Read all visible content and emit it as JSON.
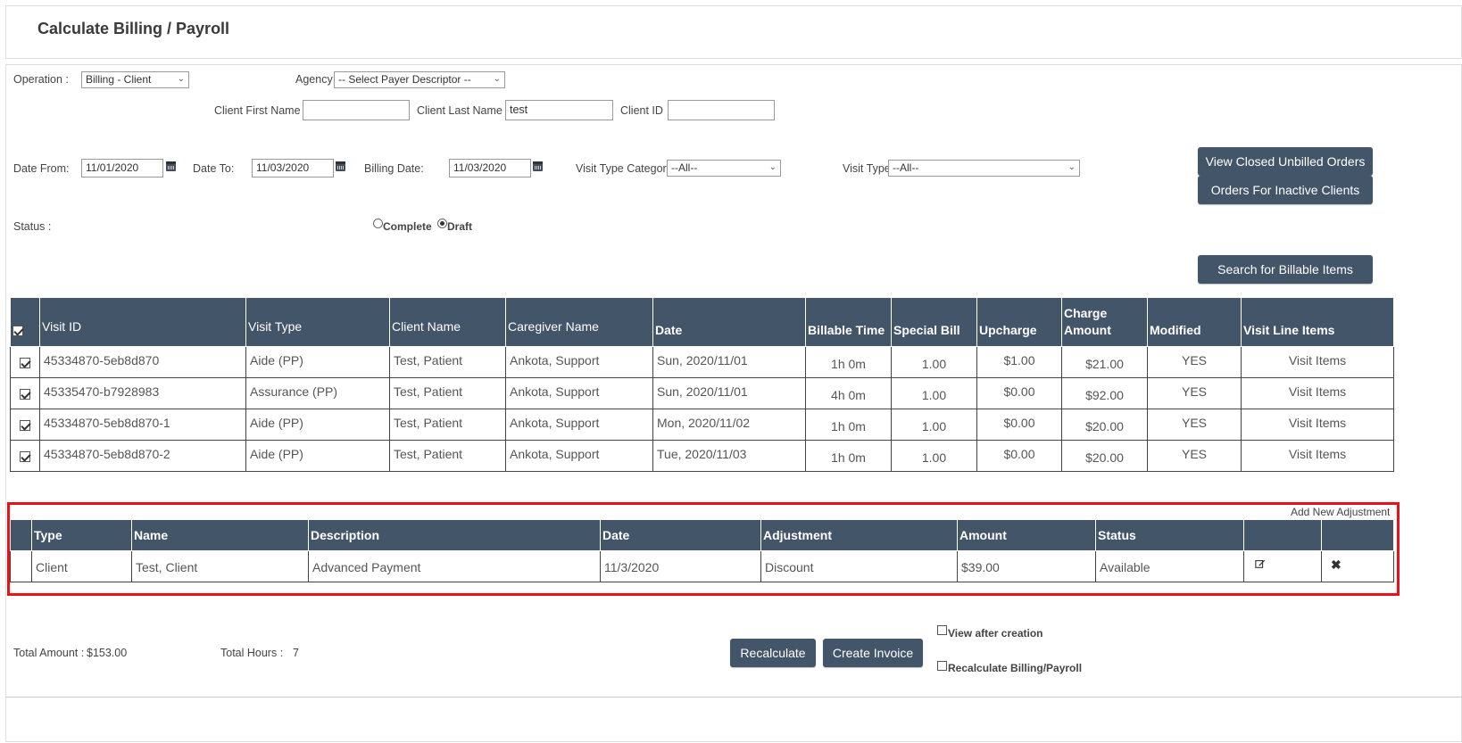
{
  "page": {
    "title": "Calculate Billing / Payroll"
  },
  "filters": {
    "operation_label": "Operation :",
    "operation_value": "Billing - Client",
    "agency_label": "Agency:",
    "agency_value": "-- Select Payer Descriptor --",
    "client_first_name_label": "Client First Name",
    "client_first_name_value": "",
    "client_last_name_label": "Client Last Name",
    "client_last_name_value": "test",
    "client_id_label": "Client ID",
    "client_id_value": "",
    "date_from_label": "Date From:",
    "date_from_value": "11/01/2020",
    "date_to_label": "Date To:",
    "date_to_value": "11/03/2020",
    "billing_date_label": "Billing Date:",
    "billing_date_value": "11/03/2020",
    "visit_type_category_label": "Visit Type Category",
    "visit_type_category_value": "--All--",
    "visit_type_label": "Visit Type",
    "visit_type_value": "--All--",
    "status_label": "Status :",
    "status_options": [
      "Complete",
      "Draft"
    ],
    "status_selected": "Draft"
  },
  "buttons": {
    "view_closed_unbilled": "View Closed Unbilled Orders",
    "orders_inactive_clients": "Orders For Inactive Clients",
    "search_billable": "Search for Billable Items",
    "recalculate": "Recalculate",
    "create_invoice": "Create Invoice"
  },
  "visits_table": {
    "headers": [
      "Visit ID",
      "Visit Type",
      "Client Name",
      "Caregiver Name",
      "Date",
      "Billable Time",
      "Special Bill",
      "Upcharge",
      "Charge Amount",
      "Modified",
      "Visit Line Items"
    ],
    "rows": [
      {
        "checked": true,
        "visit_id": "45334870-5eb8d870",
        "visit_type": "Aide (PP)",
        "client_name": "Test, Patient",
        "caregiver_name": "Ankota, Support",
        "date": "Sun, 2020/11/01",
        "billable_time": "1h 0m",
        "special_bill": "1.00",
        "upcharge": "$1.00",
        "charge_amount": "$21.00",
        "modified": "YES",
        "line_items": "Visit Items"
      },
      {
        "checked": true,
        "visit_id": "45335470-b7928983",
        "visit_type": "Assurance (PP)",
        "client_name": "Test, Patient",
        "caregiver_name": "Ankota, Support",
        "date": "Sun, 2020/11/01",
        "billable_time": "4h 0m",
        "special_bill": "1.00",
        "upcharge": "$0.00",
        "charge_amount": "$92.00",
        "modified": "YES",
        "line_items": "Visit Items"
      },
      {
        "checked": true,
        "visit_id": "45334870-5eb8d870-1",
        "visit_type": "Aide (PP)",
        "client_name": "Test, Patient",
        "caregiver_name": "Ankota, Support",
        "date": "Mon, 2020/11/02",
        "billable_time": "1h 0m",
        "special_bill": "1.00",
        "upcharge": "$0.00",
        "charge_amount": "$20.00",
        "modified": "YES",
        "line_items": "Visit Items"
      },
      {
        "checked": true,
        "visit_id": "45334870-5eb8d870-2",
        "visit_type": "Aide (PP)",
        "client_name": "Test, Patient",
        "caregiver_name": "Ankota, Support",
        "date": "Tue, 2020/11/03",
        "billable_time": "1h 0m",
        "special_bill": "1.00",
        "upcharge": "$0.00",
        "charge_amount": "$20.00",
        "modified": "YES",
        "line_items": "Visit Items"
      }
    ]
  },
  "adjustments": {
    "add_link": "Add New Adjustment",
    "headers": [
      "Type",
      "Name",
      "Description",
      "Date",
      "Adjustment",
      "Amount",
      "Status"
    ],
    "rows": [
      {
        "type": "Client",
        "name": "Test, Client",
        "description": "Advanced Payment",
        "date": "11/3/2020",
        "adjustment": "Discount",
        "amount": "$39.00",
        "status": "Available"
      }
    ]
  },
  "totals": {
    "amount_label": "Total Amount :",
    "amount_value": "$153.00",
    "hours_label": "Total Hours :",
    "hours_value": "7"
  },
  "options": {
    "view_after_creation": "View after creation",
    "recalculate_billing_payroll": "Recalculate Billing/Payroll"
  },
  "colors": {
    "header_bg": "#435568",
    "highlight_border": "#e8121b"
  }
}
